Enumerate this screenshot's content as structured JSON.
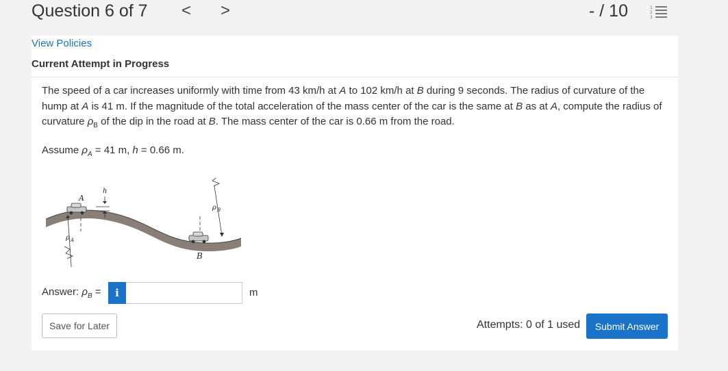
{
  "header": {
    "question_title": "Question 6 of 7",
    "prev_symbol": "<",
    "next_symbol": ">",
    "score": "- / 10"
  },
  "links": {
    "view_policies": "View Policies"
  },
  "attempt": {
    "heading": "Current Attempt in Progress"
  },
  "problem": {
    "p1": "The speed of a car increases uniformly with time from 43 km/h at ",
    "A1": "A",
    "p2": " to 102 km/h at ",
    "B1": "B",
    "p3": " during 9 seconds. The radius of curvature of the hump at ",
    "A2": "A",
    "p4": " is 41 m. If the magnitude of the total acceleration of the mass center of the car is the same at ",
    "B2": "B",
    "p5": " as at ",
    "A3": "A",
    "p6": ", compute the radius of curvature ",
    "rho": "ρ",
    "sub_b": "B",
    "p7": " of the dip in the road at ",
    "B3": "B",
    "p8": ". The mass center of the car is 0.66 m from the road."
  },
  "assume": {
    "prefix": "Assume ",
    "rho": "ρ",
    "sub_a": "A",
    "mid": " = 41 m, ",
    "h": "h",
    "end": " = 0.66 m."
  },
  "figure": {
    "label_A": "A",
    "label_h": "h",
    "label_rhoA": "ρ",
    "label_rhoA_sub": "A",
    "label_rhoB": "ρ",
    "label_rhoB_sub": "B",
    "label_B": "B"
  },
  "answer": {
    "label": "Answer: ",
    "rho": "ρ",
    "sub": "B",
    "equals": " =",
    "info_icon": "i",
    "value": "",
    "placeholder": "",
    "unit": "m"
  },
  "buttons": {
    "save_later": "Save for Later",
    "submit": "Submit Answer"
  },
  "attempts_text": "Attempts: 0 of 1 used",
  "colors": {
    "accent": "#1a73c8",
    "road": "#8a7f78"
  }
}
